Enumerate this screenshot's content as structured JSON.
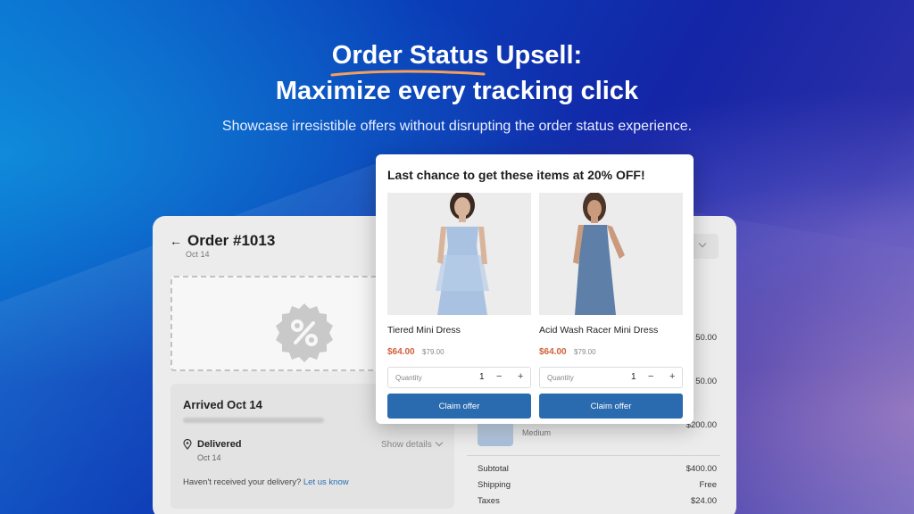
{
  "hero": {
    "title_underlined": "Order Status",
    "title_rest": " Upsell:",
    "title_line2": "Maximize every tracking click",
    "subtitle": "Showcase irresistible offers without disrupting the order status experience.",
    "underline_color": "#f5a05a"
  },
  "order": {
    "back_icon": "arrow-left-icon",
    "title": "Order #1013",
    "date": "Oct 14",
    "delivery": {
      "heading": "Arrived Oct 14",
      "status": "Delivered",
      "status_date": "Oct 14",
      "show_details": "Show details",
      "not_received_text": "Haven't received your delivery?",
      "contact_link": "Let us know"
    },
    "summary": {
      "line_prices": [
        "50.00",
        "50.00",
        "$200.00"
      ],
      "item_variant": "Medium",
      "subtotal_label": "Subtotal",
      "subtotal_value": "$400.00",
      "shipping_label": "Shipping",
      "shipping_value": "Free",
      "taxes_label": "Taxes",
      "taxes_value": "$24.00"
    }
  },
  "popup": {
    "title": "Last chance to get these items at 20% OFF!",
    "accent_color": "#2a6bb0",
    "sale_color": "#d0603a",
    "products": [
      {
        "name": "Tiered Mini Dress",
        "sale_price": "$64.00",
        "compare_price": "$79.00",
        "quantity_label": "Quantity",
        "quantity": "1",
        "claim_label": "Claim offer"
      },
      {
        "name": "Acid Wash Racer Mini Dress",
        "sale_price": "$64.00",
        "compare_price": "$79.00",
        "quantity_label": "Quantity",
        "quantity": "1",
        "claim_label": "Claim offer"
      }
    ]
  }
}
